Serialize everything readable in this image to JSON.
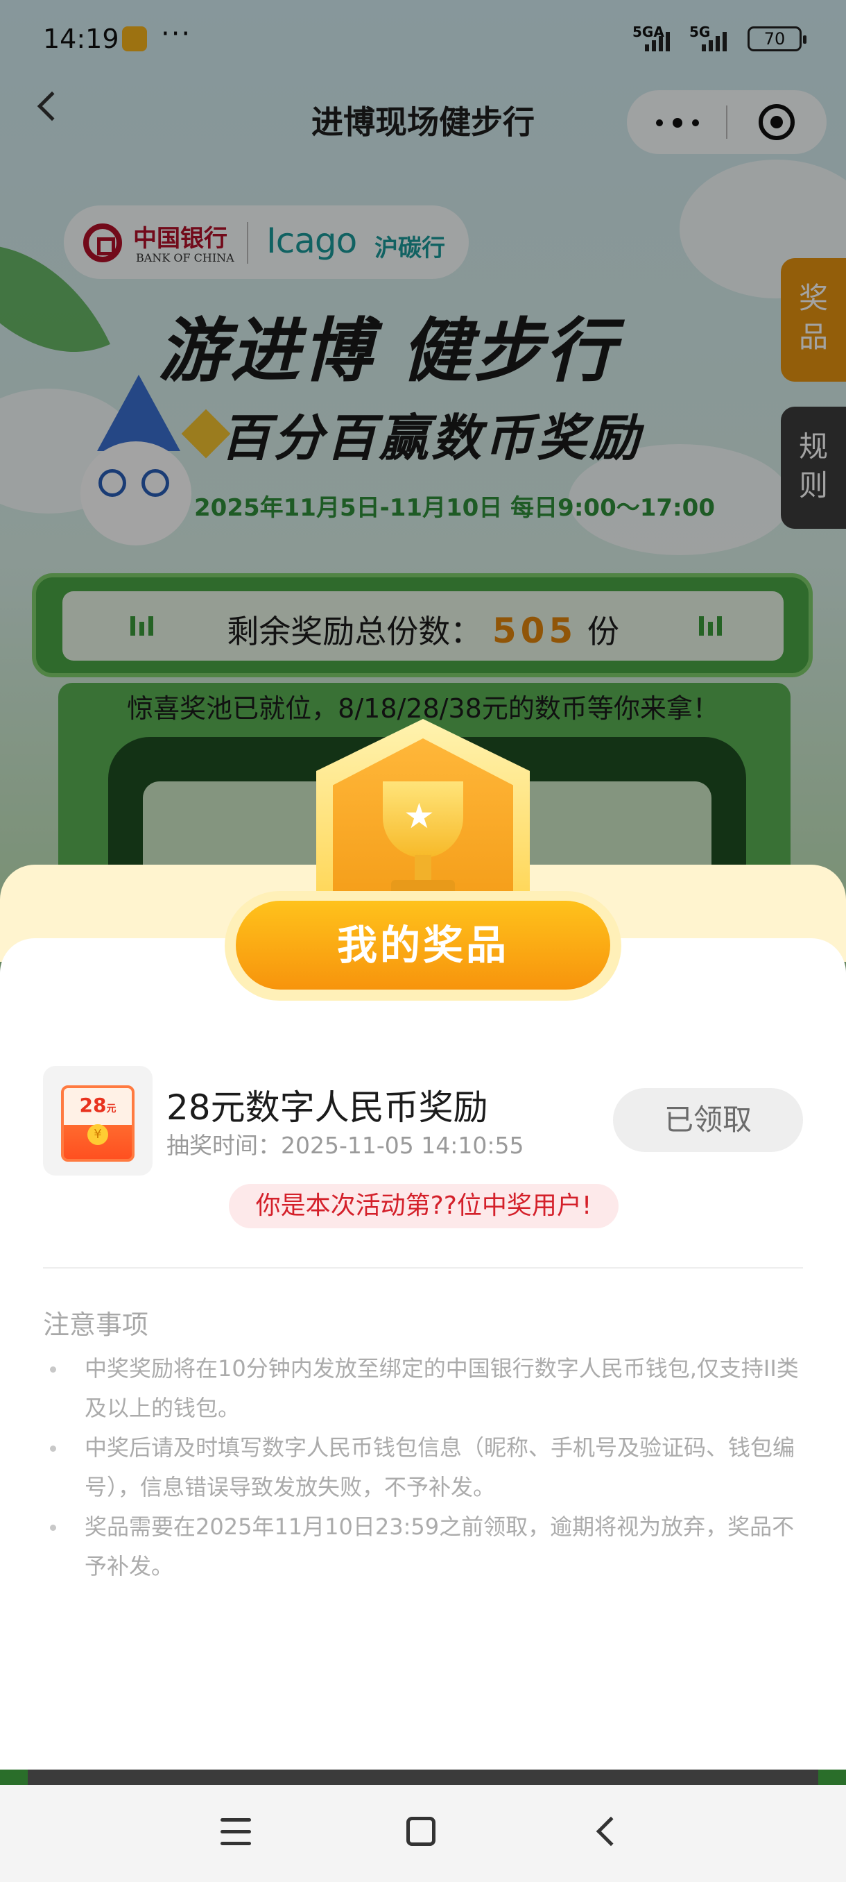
{
  "status_bar": {
    "time": "14:19",
    "dots": "···",
    "signal_1": "5GA",
    "signal_2": "5G",
    "battery": "70"
  },
  "nav": {
    "title": "进博现场健步行"
  },
  "banner": {
    "bank_name_cn": "中国银行",
    "bank_name_en": "BANK OF CHINA",
    "partner_logo": "Icago",
    "partner_name_cn": "沪碳行",
    "headline": "游进博 健步行",
    "subheadline": "百分百赢数币奖励",
    "date_line": "2025年11月5日-11月10日 每日9:00～17:00"
  },
  "side_tabs": {
    "prize": [
      "奖",
      "品"
    ],
    "rules": [
      "规",
      "则"
    ]
  },
  "counter": {
    "label": "剩余奖励总份数：",
    "value": "505",
    "unit": "份"
  },
  "pool_text": "惊喜奖池已就位，8/18/28/38元的数币等你来拿！",
  "sheet": {
    "title": "我的奖品",
    "prize": {
      "amount": "28",
      "amount_unit": "元",
      "coin_symbol": "¥",
      "title": "28元数字人民币奖励",
      "time_label": "抽奖时间：",
      "time_value": "2025-11-05 14:10:55",
      "status_button": "已领取"
    },
    "winner_tag": "你是本次活动第??位中奖用户!",
    "notes_title": "注意事项",
    "notes": [
      "中奖奖励将在10分钟内发放至绑定的中国银行数字人民币钱包,仅支持II类及以上的钱包。",
      "中奖后请及时填写数字人民币钱包信息（昵称、手机号及验证码、钱包编号），信息错误导致发放失败，不予补发。",
      "奖品需要在2025年11月10日23:59之前领取，逾期将视为放弃，奖品不予补发。"
    ]
  },
  "colors": {
    "accent_orange": "#f7940c",
    "winner_red": "#d4202a",
    "boc_red": "#b2112a",
    "green": "#4aa645"
  },
  "icons": [
    "back-icon",
    "more-icon",
    "target-icon",
    "trophy-icon",
    "red-envelope-icon",
    "menu-icon",
    "home-icon",
    "nav-back-icon"
  ]
}
